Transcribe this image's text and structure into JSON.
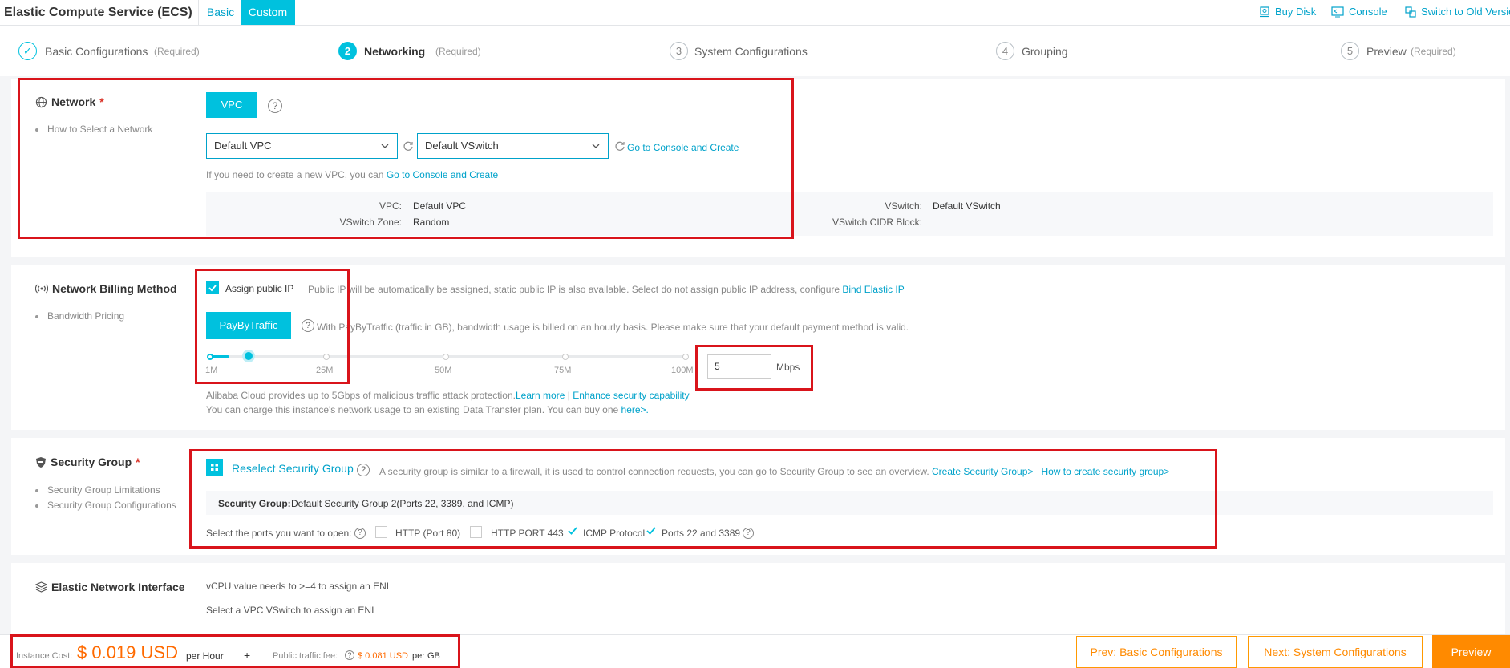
{
  "header": {
    "title": "Elastic Compute Service (ECS)",
    "modes": [
      "Basic",
      "Custom"
    ],
    "active_mode": "Custom",
    "links": [
      {
        "label": "Buy Disk",
        "icon": "disk-cart-icon"
      },
      {
        "label": "Console",
        "icon": "console-icon"
      },
      {
        "label": "Switch to Old Version",
        "icon": "switch-icon"
      }
    ]
  },
  "steps": [
    {
      "number": "✓",
      "label": "Basic Configurations",
      "required": "(Required)",
      "state": "done"
    },
    {
      "number": "2",
      "label": "Networking",
      "required": "(Required)",
      "state": "active"
    },
    {
      "number": "3",
      "label": "System Configurations",
      "required": "",
      "state": "pending"
    },
    {
      "number": "4",
      "label": "Grouping",
      "required": "",
      "state": "pending"
    },
    {
      "number": "5",
      "label": "Preview",
      "required": "(Required)",
      "state": "pending"
    }
  ],
  "network": {
    "title": "Network",
    "required_mark": "*",
    "side_link": "How to Select a Network",
    "vpc_button": "VPC",
    "vpc_select": "Default VPC",
    "vswitch_select": "Default VSwitch",
    "create_link": "Go to Console and Create",
    "hint_prefix": "If you need to create a new VPC, you can",
    "hint_link": "Go to Console and Create",
    "summary": {
      "vpc_label": "VPC:",
      "vpc_value": "Default VPC",
      "zone_label": "VSwitch Zone:",
      "zone_value": "Random",
      "vswitch_label": "VSwitch:",
      "vswitch_value": "Default VSwitch",
      "cidr_label": "VSwitch CIDR Block:",
      "cidr_value": ""
    }
  },
  "billing": {
    "title": "Network Billing Method",
    "side_link": "Bandwidth Pricing",
    "assign_ip_label": "Assign public IP",
    "assign_ip_checked": true,
    "assign_ip_desc": "Public IP will be automatically be assigned, static public IP is also available. Select do not assign public IP address, configure",
    "bind_eip_link": "Bind Elastic IP",
    "pay_button": "PayByTraffic",
    "pay_desc": "With PayByTraffic (traffic in GB), bandwidth usage is billed on an hourly basis. Please make sure that your default payment method is valid.",
    "slider_ticks": [
      "1M",
      "25M",
      "50M",
      "75M",
      "100M"
    ],
    "slider_value": 5,
    "slider_max": 100,
    "bandwidth_value": "5",
    "bandwidth_unit": "Mbps",
    "protection_text": "Alibaba Cloud provides up to 5Gbps of malicious traffic attack protection.",
    "learn_more": "Learn more",
    "separator": "|",
    "enhance_link": "Enhance security capability",
    "plan_text": "You can charge this instance's network usage to an existing Data Transfer plan. You can buy one",
    "plan_link": "here>."
  },
  "security": {
    "title": "Security Group",
    "required_mark": "*",
    "side_links": [
      "Security Group Limitations",
      "Security Group Configurations"
    ],
    "reselect_label": "Reselect Security Group",
    "desc": "A security group is similar to a firewall, it is used to control connection requests, you can go to Security Group to see an overview.",
    "create_link": "Create Security Group>",
    "howto_link": "How to create security group>",
    "group_label": "Security Group:",
    "group_value": "Default Security Group 2(Ports 22, 3389, and ICMP)",
    "ports_label": "Select the ports you want to open:",
    "ports": [
      {
        "label": "HTTP (Port 80)",
        "checked": false
      },
      {
        "label": "HTTP PORT 443",
        "checked": false
      },
      {
        "label": "ICMP Protocol",
        "checked": true
      },
      {
        "label": "Ports 22 and 3389",
        "checked": true
      }
    ]
  },
  "eni": {
    "title": "Elastic Network Interface",
    "line1": "vCPU value needs to >=4 to assign an ENI",
    "line2": "Select a VPC VSwitch to assign an ENI"
  },
  "footer": {
    "instance_cost_label": "Instance Cost:",
    "instance_cost_value": "$ 0.019 USD",
    "per_hour": "per Hour",
    "plus": "+",
    "traffic_fee_label": "Public traffic fee:",
    "traffic_fee_value": "$ 0.081 USD",
    "per_gb": "per GB",
    "prev_button": "Prev: Basic Configurations",
    "next_button": "Next: System Configurations",
    "preview_button": "Preview"
  },
  "colors": {
    "accent": "#00c1de",
    "link": "#00a2ca",
    "highlight": "#d9141b",
    "cost": "#ff6a00"
  }
}
